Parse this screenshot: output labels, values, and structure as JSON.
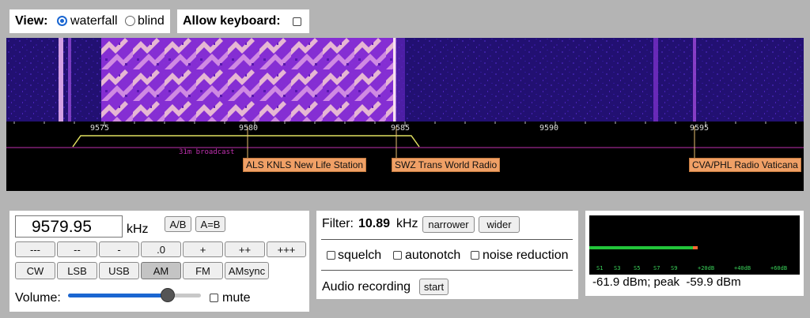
{
  "view": {
    "label": "View:",
    "options": [
      "waterfall",
      "blind"
    ],
    "selected": "waterfall"
  },
  "keyboard": {
    "label": "Allow keyboard:",
    "checked": false
  },
  "spectrum": {
    "ticks": [
      "9575",
      "9580",
      "9585",
      "9590",
      "9595"
    ],
    "band_label": "31m broadcast",
    "stations": [
      "ALS KNLS New Life Station",
      "SWZ Trans World Radio",
      "CVA/PHL Radio Vaticana"
    ]
  },
  "tuner": {
    "frequency": "9579.95",
    "unit": "kHz",
    "ab_label": "A/B",
    "aeqb_label": "A=B",
    "steps": [
      "---",
      "--",
      "-",
      ".0",
      "+",
      "++",
      "+++"
    ],
    "modes": [
      "CW",
      "LSB",
      "USB",
      "AM",
      "FM",
      "AMsync"
    ],
    "active_mode": "AM",
    "volume_label": "Volume:",
    "volume_level": 0.78,
    "mute_label": "mute"
  },
  "filter": {
    "label": "Filter:",
    "value": "10.89",
    "unit": "kHz",
    "narrower": "narrower",
    "wider": "wider",
    "squelch": "squelch",
    "autonotch": "autonotch",
    "noise_reduction": "noise reduction",
    "audio_recording": "Audio recording",
    "start": "start"
  },
  "smeter": {
    "scale": [
      "S1",
      "S3",
      "S5",
      "S7",
      "S9",
      "+20dB",
      "+40dB",
      "+60dB"
    ],
    "reading": "-61.9 dBm; peak  -59.9 dBm",
    "colors": {
      "bar": "#22c43a",
      "peak": "#ff6633",
      "scale": "#3ad35a"
    }
  },
  "colors": {
    "waterfall_bg": "#1d0f6e",
    "waterfall_hot": "#b545ea",
    "filter_passband": "#e0e060",
    "marker_line": "#e8c070",
    "band_line": "#c030b0"
  }
}
